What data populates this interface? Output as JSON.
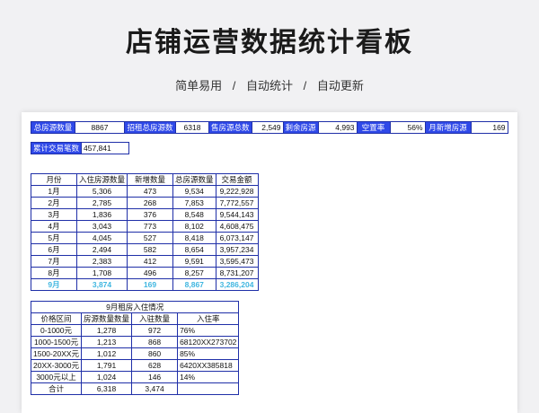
{
  "page": {
    "title": "店铺运营数据统计看板",
    "subtitle": [
      "简单易用",
      "自动统计",
      "自动更新"
    ],
    "separator": "/"
  },
  "kpis": [
    {
      "label": "总房源数量",
      "value": "8867"
    },
    {
      "label": "招租总房源数",
      "value": "6318"
    },
    {
      "label": "售房源总数",
      "value": "2,549"
    },
    {
      "label": "剩余房源",
      "value": "4,993"
    },
    {
      "label": "空置率",
      "value": "56%"
    },
    {
      "label": "月新增房源",
      "value": "169"
    }
  ],
  "trade": {
    "label": "累计交易笔数",
    "value": "457,841"
  },
  "monthly": {
    "headers": [
      "月份",
      "入住房源数量",
      "新增数量",
      "总房源数量",
      "交易金额"
    ],
    "rows": [
      [
        "1月",
        "5,306",
        "473",
        "9,534",
        "9,222,928"
      ],
      [
        "2月",
        "2,785",
        "268",
        "7,853",
        "7,772,557"
      ],
      [
        "3月",
        "1,836",
        "376",
        "8,548",
        "9,544,143"
      ],
      [
        "4月",
        "3,043",
        "773",
        "8,102",
        "4,608,475"
      ],
      [
        "5月",
        "4,045",
        "527",
        "8,418",
        "6,073,147"
      ],
      [
        "6月",
        "2,494",
        "582",
        "8,654",
        "3,957,234"
      ],
      [
        "7月",
        "2,383",
        "412",
        "9,591",
        "3,595,473"
      ],
      [
        "8月",
        "1,708",
        "496",
        "8,257",
        "8,731,207"
      ]
    ],
    "highlight": [
      "9月",
      "3,874",
      "169",
      "8,867",
      "3,286,204"
    ]
  },
  "september": {
    "title": "9月租房入住情况",
    "headers": [
      "价格区间",
      "房源数量数量",
      "入驻数量",
      "入住率"
    ],
    "rows": [
      [
        "0-1000元",
        "1,278",
        "972",
        "76%"
      ],
      [
        "1000-1500元",
        "1,213",
        "868",
        "68120XX273702"
      ],
      [
        "1500-20XX元",
        "1,012",
        "860",
        "85%"
      ],
      [
        "20XX-3000元",
        "1,791",
        "628",
        "6420XX385818"
      ],
      [
        "3000元以上",
        "1,024",
        "146",
        "14%"
      ],
      [
        "合计",
        "6,318",
        "3,474",
        ""
      ]
    ]
  }
}
